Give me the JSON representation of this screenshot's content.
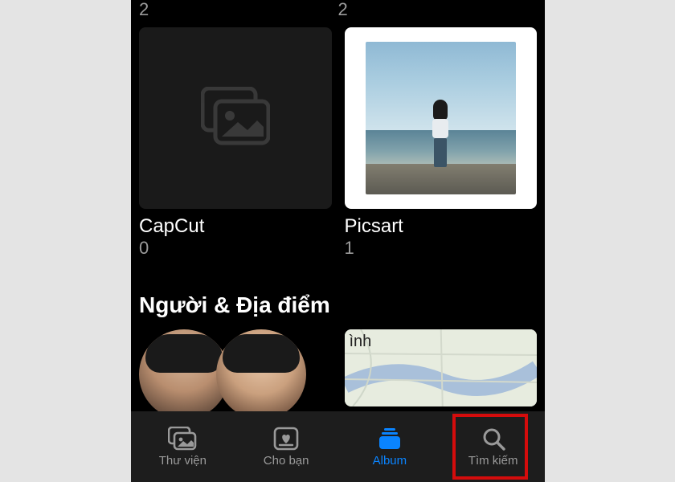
{
  "top_counts": {
    "left": "2",
    "right": "2"
  },
  "albums": [
    {
      "name": "CapCut",
      "count": "0"
    },
    {
      "name": "Picsart",
      "count": "1"
    }
  ],
  "section_people_places": "Người & Địa điểm",
  "map_partial_label": "ình",
  "tabs": {
    "library": "Thư viện",
    "for_you": "Cho bạn",
    "album": "Album",
    "search": "Tìm kiếm"
  },
  "active_tab": "album"
}
